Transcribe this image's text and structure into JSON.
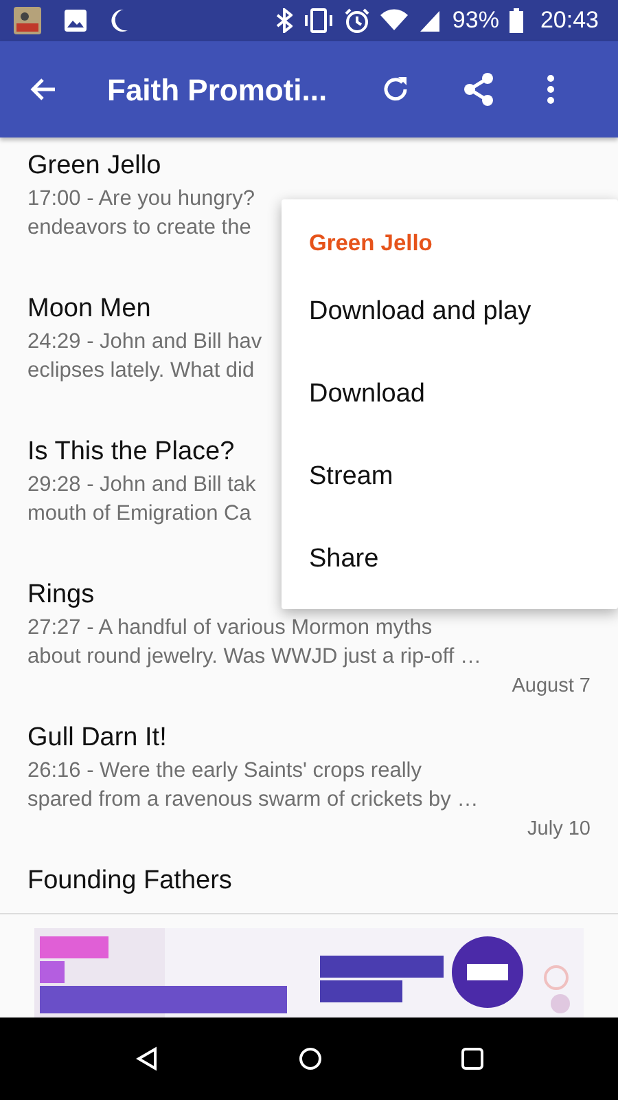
{
  "status_bar": {
    "battery": "93%",
    "time": "20:43"
  },
  "app_bar": {
    "title": "Faith Promoti..."
  },
  "episodes": [
    {
      "title": "Green Jello",
      "lines": [
        "17:00 - Are you hungry?",
        "endeavors to create the"
      ]
    },
    {
      "title": "Moon Men",
      "lines": [
        "24:29 - John and Bill hav",
        "eclipses lately. What did"
      ]
    },
    {
      "title": "Is This the Place?",
      "lines": [
        "29:28 - John and Bill tak",
        "mouth of Emigration Ca"
      ]
    },
    {
      "title": "Rings",
      "lines": [
        "27:27 - A handful of various Mormon myths",
        "about round jewelry. Was WWJD just a rip-off …"
      ],
      "date": "August 7"
    },
    {
      "title": "Gull Darn It!",
      "lines": [
        "26:16 - Were the early Saints' crops really",
        "spared from a ravenous swarm of crickets by …"
      ],
      "date": "July 10"
    },
    {
      "title": "Founding Fathers"
    }
  ],
  "menu": {
    "header": "Green Jello",
    "items": [
      "Download and play",
      "Download",
      "Stream",
      "Share"
    ]
  }
}
